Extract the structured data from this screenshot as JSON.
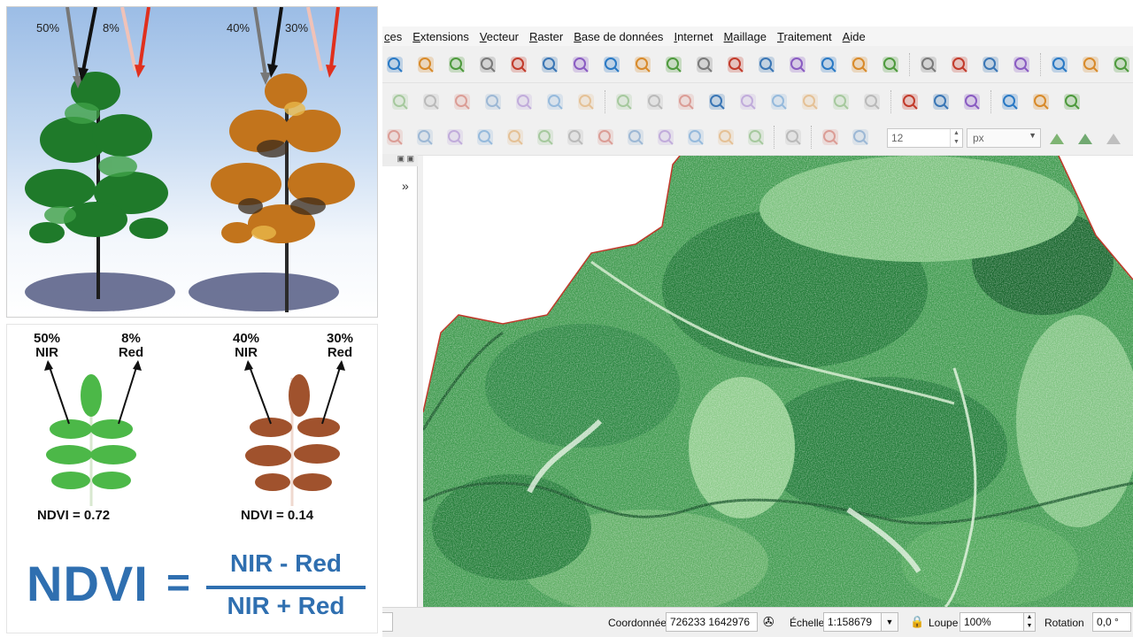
{
  "illustration": {
    "top": {
      "left_nir_pct": "50%",
      "left_red_pct": "8%",
      "right_nir_pct": "40%",
      "right_red_pct": "30%"
    },
    "bottom": {
      "left_nir_pct": "50%",
      "left_nir_label": "NIR",
      "left_red_pct": "8%",
      "left_red_label": "Red",
      "right_nir_pct": "40%",
      "right_nir_label": "NIR",
      "right_red_pct": "30%",
      "right_red_label": "Red",
      "left_ndvi": "NDVI = 0.72",
      "right_ndvi": "NDVI = 0.14"
    },
    "formula": {
      "lhs": "NDVI",
      "equals": "=",
      "numerator": "NIR - Red",
      "denominator": "NIR + Red"
    },
    "colors": {
      "formula_blue": "#2f6fb0",
      "healthy_leaf": "#4cb848",
      "stressed_leaf": "#a0522d",
      "red_arrow": "#e0301e"
    }
  },
  "qgis": {
    "menu": [
      "ces",
      "Extensions",
      "Vecteur",
      "Raster",
      "Base de données",
      "Internet",
      "Maillage",
      "Traitement",
      "Aide"
    ],
    "toolbar": {
      "row1_icons": [
        "pan-icon",
        "pan-to-selection-icon",
        "zoom-in-icon",
        "zoom-out-icon",
        "zoom-full-icon",
        "zoom-to-selection-icon",
        "zoom-to-layer-icon",
        "zoom-native-icon",
        "zoom-last-icon",
        "zoom-next-icon",
        "new-map-view-icon",
        "new-3d-view-icon",
        "temporal-controller-icon",
        "bookmark-icon",
        "show-bookmarks-icon",
        "clock-icon",
        "refresh-icon",
        "select-feature-icon",
        "select-value-icon",
        "deselect-icon",
        "select-location-icon",
        "identify-icon",
        "attribute-table-icon",
        "stats-icon"
      ],
      "row2_icons": [
        "edit-pencil-icon",
        "delete-icon",
        "cut-icon",
        "copy-icon",
        "paste-icon",
        "undo-icon",
        "redo-icon",
        "label-abc-icon",
        "label-pin-icon",
        "label-highlight-icon",
        "label-red-icon",
        "label-move-icon",
        "label-rotate-icon",
        "label-change-icon",
        "label-show-icon",
        "label-hide-icon",
        "database-icon",
        "globe-car-icon",
        "globe-add-icon",
        "globe-search-icon",
        "python-icon",
        "processing-icon"
      ],
      "row3_icons": [
        "digitize-1-icon",
        "digitize-2-icon",
        "digitize-3-icon",
        "digitize-4-icon",
        "digitize-5-icon",
        "digitize-6-icon",
        "digitize-7-icon",
        "digitize-8-icon",
        "digitize-9-icon",
        "digitize-10-icon",
        "digitize-11-icon",
        "digitize-12-icon",
        "digitize-13-icon",
        "rotate-icon",
        "snapping-magnet-icon",
        "snap-vertex-icon",
        "snap-grid-icon",
        "trace-icon",
        "topology-icon",
        "cross-icon"
      ],
      "tolerance_value": "12",
      "tolerance_unit": "px"
    },
    "dock": {
      "expand_label": "»"
    },
    "status": {
      "coord_label": "Coordonnée",
      "coord_value": "726233  1642976",
      "scale_label": "Échelle",
      "scale_value": "1:158679",
      "magnifier_label": "Loupe",
      "magnifier_value": "100%",
      "rotation_label": "Rotation",
      "rotation_value": "0,0 °"
    },
    "colors": {
      "ndvi_dark": "#0e5a25",
      "ndvi_mid": "#3a8f48",
      "ndvi_light": "#cfe8c8",
      "boundary": "#c0392b"
    }
  }
}
